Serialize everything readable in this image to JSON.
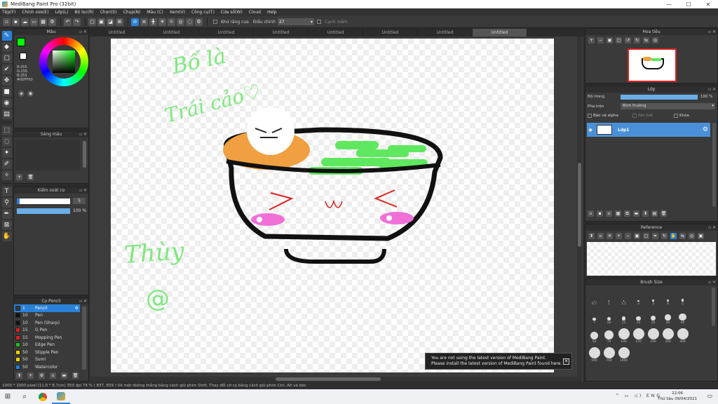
{
  "window": {
    "title": "MediBang Paint Pro (32bit)",
    "controls": [
      "—",
      "☐",
      "✕"
    ]
  },
  "menu": [
    "Tệp(F)",
    "Chỉnh sửa(E)",
    "Lớp(L)",
    "Bộ lọc(R)",
    "Chọn(S)",
    "Chụp(N)",
    "Màu (C)",
    "Xem(V)",
    "Công cụ(T)",
    "Cửa sổ(W)",
    "Cloud",
    "Help"
  ],
  "toolbar": {
    "correction_label": "Khử răng cưa",
    "adjust_label": "Điều chỉnh",
    "adjust_value": "27",
    "snap_label": "Cạnh mềm"
  },
  "tabs": [
    "Untitled",
    "Untitled",
    "Untitled",
    "Untitled",
    "Untitled",
    "Untitled",
    "Untitled",
    "Untitled"
  ],
  "panels": {
    "color": {
      "title": "Màu",
      "rgb": [
        "R:255",
        "G:255",
        "B:255"
      ],
      "hex": "#00FF00"
    },
    "color_history": {
      "title": "Sáng màu"
    },
    "brush_control": {
      "title": "Kiểm soát cọ",
      "size": "5",
      "opacity": "100 %",
      "size_fraction": 0.05,
      "opacity_fraction": 1.0
    },
    "brushes": {
      "title": "Cọ Pencil",
      "items": [
        {
          "size": "1",
          "name": "Pencil",
          "color": "#3a3a3a",
          "selected": true
        },
        {
          "size": "10",
          "name": "Pen",
          "color": "#111111"
        },
        {
          "size": "10",
          "name": "Pen (Sharp)",
          "color": "#111111"
        },
        {
          "size": "15",
          "name": "G Pen",
          "color": "#e02020"
        },
        {
          "size": "15",
          "name": "Mapping Pen",
          "color": "#e02020"
        },
        {
          "size": "10",
          "name": "Edge Pen",
          "color": "#20c020"
        },
        {
          "size": "50",
          "name": "Stipple Pen",
          "color": "#f0d000"
        },
        {
          "size": "50",
          "name": "Sumi",
          "color": "#f0d000"
        },
        {
          "size": "50",
          "name": "Watercolor",
          "color": "#2080e0"
        }
      ]
    },
    "navigator": {
      "title": "Hoa tiêu"
    },
    "layer": {
      "title": "Lớp",
      "opacity_label": "Độ trong",
      "opacity_value": "100 %",
      "blend_label": "Pha trộn",
      "blend_value": "Bình thường",
      "protect_alpha": "Bảo vệ alpha",
      "clipping": "Xén bớt",
      "lock": "Khóa",
      "layer_name": "Lớp1"
    },
    "reference": {
      "title": "Reference"
    },
    "brush_size": {
      "title": "Brush Size",
      "sizes": [
        "0.7",
        "1",
        "1.5",
        "2",
        "3",
        "4",
        "5",
        "7",
        "10",
        "12",
        "15",
        "20",
        "30",
        "40",
        "50",
        "70",
        "100",
        "150",
        "200",
        "300",
        "400",
        "500",
        "700",
        "1000"
      ]
    }
  },
  "canvas": {
    "texts": {
      "line1": "Bố là",
      "line2": "Trái cảo♡",
      "line3": "Thùy",
      "line4": "@"
    }
  },
  "notice": {
    "line1": "You are not using the latest version of MediBang Paint.",
    "line2": "Please install the latest version of MediBang Paint found here."
  },
  "status": "1000 * 1000 pixel   (11.6 * 8.7cm)   350 dpi   74 %   ( 837, 659 )   Vẽ một đường thẳng bằng cách giữ phím Shift, Thay đổi cỡ cọ bằng cách giữ phím Ctrl, Alt và kéo",
  "taskbar": {
    "time": "22:06",
    "date": "Thứ Sáu 09/04/2021"
  },
  "colors": {
    "accent": "#2a82d8",
    "fg": "#00ff00",
    "stroke_green": "#5fe85f",
    "bowl_orange": "#f0a040",
    "cheek_pink": "#f070d8"
  }
}
